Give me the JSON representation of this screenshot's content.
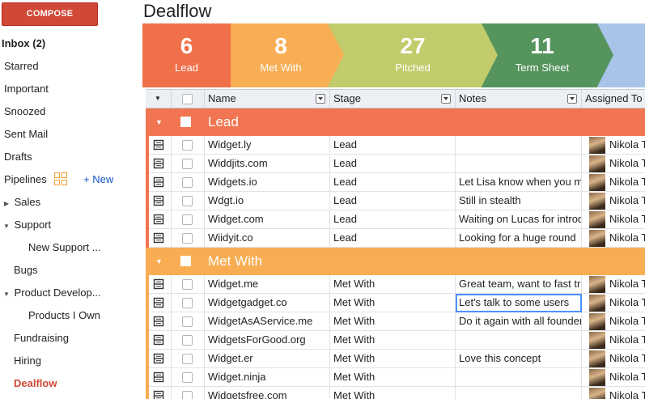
{
  "sidebar": {
    "compose_label": "COMPOSE",
    "items": [
      {
        "label": "Inbox (2)"
      },
      {
        "label": "Starred"
      },
      {
        "label": "Important"
      },
      {
        "label": "Snoozed"
      },
      {
        "label": "Sent Mail"
      },
      {
        "label": "Drafts"
      },
      {
        "label": "Pipelines",
        "new_label": "+ New"
      },
      {
        "label": "Sales"
      },
      {
        "label": "Support"
      },
      {
        "label": "New Support ..."
      },
      {
        "label": "Bugs"
      },
      {
        "label": "Product Develop..."
      },
      {
        "label": "Products I Own"
      },
      {
        "label": "Fundraising"
      },
      {
        "label": "Hiring"
      },
      {
        "label": "Dealflow"
      }
    ]
  },
  "main": {
    "title": "Dealflow",
    "stages": [
      {
        "count": "6",
        "label": "Lead",
        "color": "#f0704a"
      },
      {
        "count": "8",
        "label": "Met With",
        "color": "#f8ae55"
      },
      {
        "count": "27",
        "label": "Pitched",
        "color": "#c2cc6c"
      },
      {
        "count": "11",
        "label": "Term Sheet",
        "color": "#56945e"
      },
      {
        "count": "",
        "label": "",
        "color": "#a8c4e8"
      }
    ],
    "columns": {
      "name": "Name",
      "stage": "Stage",
      "notes": "Notes",
      "assigned": "Assigned To"
    },
    "groups": [
      {
        "label": "Lead",
        "color": "#f07550",
        "rows": [
          {
            "name": "Widget.ly",
            "stage": "Lead",
            "notes": "",
            "assigned": "Nikola T"
          },
          {
            "name": "Widdjits.com",
            "stage": "Lead",
            "notes": "",
            "assigned": "Nikola T"
          },
          {
            "name": "Widgets.io",
            "stage": "Lead",
            "notes": "Let Lisa know when you m",
            "assigned": "Nikola T"
          },
          {
            "name": "Wdgt.io",
            "stage": "Lead",
            "notes": "Still in stealth",
            "assigned": "Nikola T"
          },
          {
            "name": "Widget.com",
            "stage": "Lead",
            "notes": "Waiting on Lucas for introd",
            "assigned": "Nikola T"
          },
          {
            "name": "Wiidyit.co",
            "stage": "Lead",
            "notes": "Looking for a huge round",
            "assigned": "Nikola T"
          }
        ]
      },
      {
        "label": "Met With",
        "color": "#f8ad52",
        "rows": [
          {
            "name": "Widget.me",
            "stage": "Met With",
            "notes": "Great team, want to fast tr",
            "assigned": "Nikola T"
          },
          {
            "name": "Widgetgadget.co",
            "stage": "Met With",
            "notes": "Let's talk to some users",
            "assigned": "Nikola T"
          },
          {
            "name": "WidgetAsAService.me",
            "stage": "Met With",
            "notes": "Do it again with all founder",
            "assigned": "Nikola T"
          },
          {
            "name": "WidgetsForGood.org",
            "stage": "Met With",
            "notes": "",
            "assigned": "Nikola T"
          },
          {
            "name": "Widget.er",
            "stage": "Met With",
            "notes": "Love this concept",
            "assigned": "Nikola T"
          },
          {
            "name": "Widget.ninja",
            "stage": "Met With",
            "notes": "",
            "assigned": "Nikola T"
          },
          {
            "name": "Widgetsfree.com",
            "stage": "Met With",
            "notes": "",
            "assigned": "Nikola T"
          }
        ]
      }
    ]
  }
}
